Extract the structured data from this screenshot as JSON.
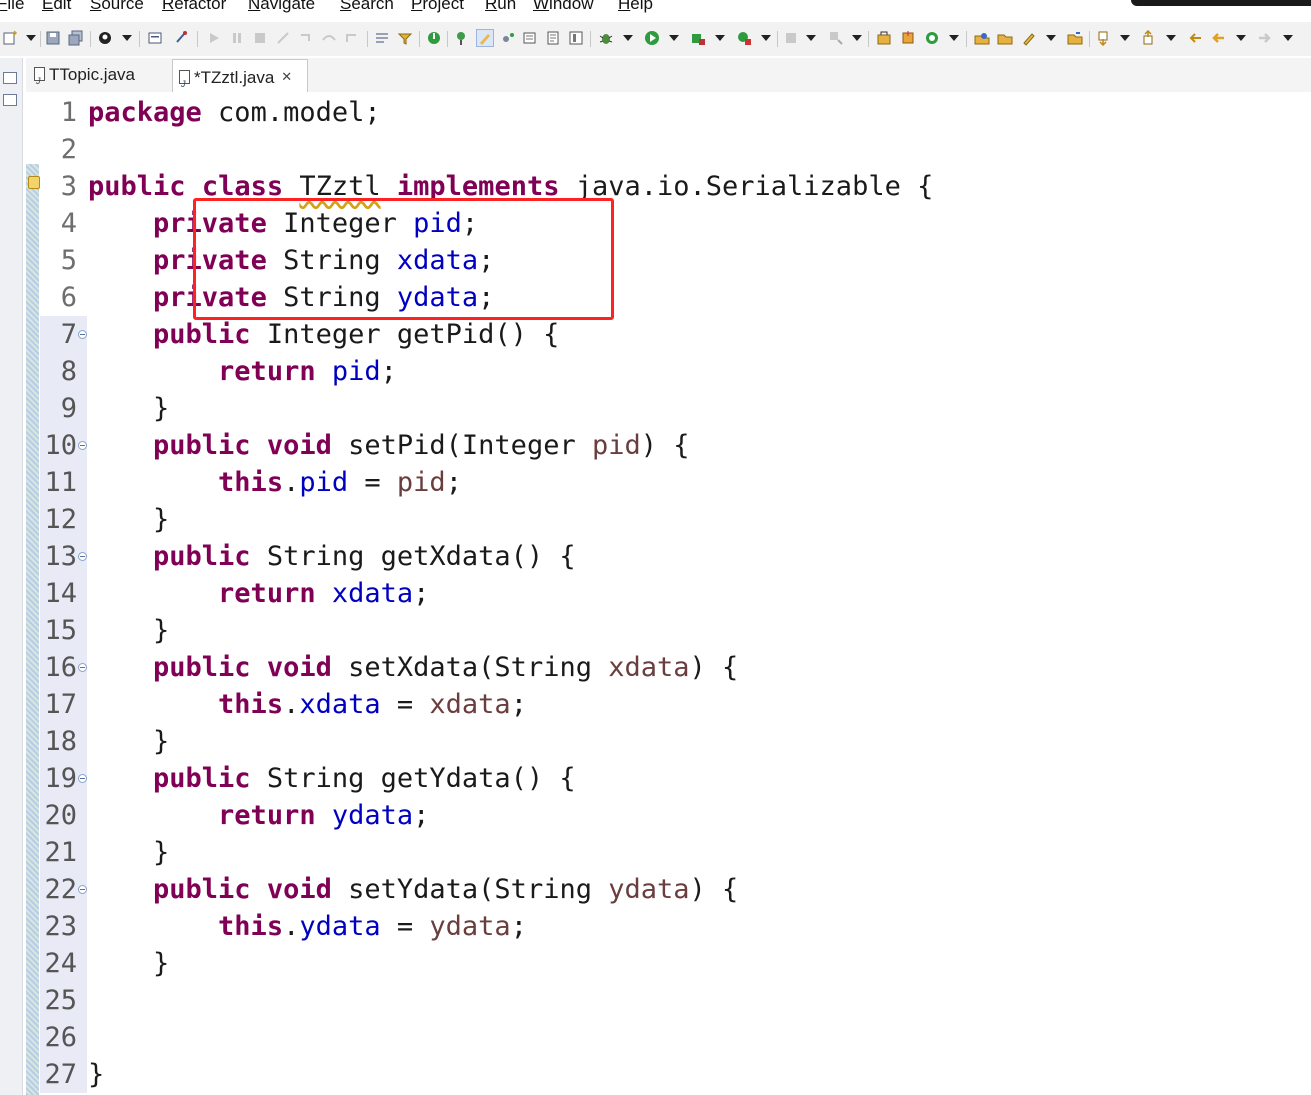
{
  "menubar": {
    "items": [
      "File",
      "Edit",
      "Source",
      "Refactor",
      "Navigate",
      "Search",
      "Project",
      "Run",
      "Window",
      "Help"
    ]
  },
  "toolbar": {
    "icons": [
      "new-icon",
      "save-icon",
      "save-all-icon",
      "profile-icon",
      "console-icon",
      "pin-icon",
      "resume-icon",
      "suspend-icon",
      "terminate-icon",
      "disconnect-icon",
      "step-into-icon",
      "step-over-icon",
      "step-return-icon",
      "drop-to-frame-icon",
      "use-step-filters-icon",
      "new-server-icon",
      "publish-icon",
      "open-type-icon",
      "open-task-icon",
      "debug-icon",
      "run-icon",
      "coverage-icon",
      "external-tools-icon",
      "stop-icon",
      "build-icon",
      "new-java-package-icon",
      "new-java-class-icon",
      "open-perspective-icon",
      "search-icon",
      "open-folder-icon",
      "annotation-icon",
      "next-annotation-icon",
      "prev-annotation-icon",
      "last-edit-icon",
      "back-icon",
      "forward-icon"
    ]
  },
  "editor": {
    "tabs": [
      {
        "label": "TTopic.java",
        "active": false
      },
      {
        "label": "*TZztl.java",
        "active": true,
        "close": "✕"
      }
    ],
    "lines": [
      {
        "n": "1"
      },
      {
        "n": "2"
      },
      {
        "n": "3"
      },
      {
        "n": "4"
      },
      {
        "n": "5"
      },
      {
        "n": "6"
      },
      {
        "n": "7"
      },
      {
        "n": "8"
      },
      {
        "n": "9"
      },
      {
        "n": "10"
      },
      {
        "n": "11"
      },
      {
        "n": "12"
      },
      {
        "n": "13"
      },
      {
        "n": "14"
      },
      {
        "n": "15"
      },
      {
        "n": "16"
      },
      {
        "n": "17"
      },
      {
        "n": "18"
      },
      {
        "n": "19"
      },
      {
        "n": "20"
      },
      {
        "n": "21"
      },
      {
        "n": "22"
      },
      {
        "n": "23"
      },
      {
        "n": "24"
      },
      {
        "n": "25"
      },
      {
        "n": "26"
      },
      {
        "n": "27"
      }
    ],
    "code": {
      "l1": {
        "kw": "package",
        "rest": " com.model;"
      },
      "l3": {
        "kw1": "public",
        "kw2": "class",
        "cls": "TZztl",
        "kw3": "implements",
        "rest": " java.io.Serializable {"
      },
      "l4": {
        "indent": "    ",
        "kw": "private",
        "type": " Integer ",
        "fld": "pid",
        "end": ";"
      },
      "l5": {
        "indent": "    ",
        "kw": "private",
        "type": " String ",
        "fld": "xdata",
        "end": ";"
      },
      "l6": {
        "indent": "    ",
        "kw": "private",
        "type": " String ",
        "fld": "ydata",
        "end": ";"
      },
      "l7": {
        "indent": "    ",
        "kw": "public",
        "rest": " Integer getPid() {"
      },
      "l8": {
        "indent": "        ",
        "kw": "return",
        "sp": " ",
        "fld": "pid",
        "end": ";"
      },
      "l9": {
        "text": "    }"
      },
      "l10": {
        "indent": "    ",
        "kw1": "public",
        "kw2": "void",
        "mid": " setPid(Integer ",
        "prm": "pid",
        "end": ") {"
      },
      "l11": {
        "indent": "        ",
        "kw": "this",
        "dot": ".",
        "fld": "pid",
        "eq": " = ",
        "prm": "pid",
        "end": ";"
      },
      "l12": {
        "text": "    }"
      },
      "l13": {
        "indent": "    ",
        "kw": "public",
        "rest": " String getXdata() {"
      },
      "l14": {
        "indent": "        ",
        "kw": "return",
        "sp": " ",
        "fld": "xdata",
        "end": ";"
      },
      "l15": {
        "text": "    }"
      },
      "l16": {
        "indent": "    ",
        "kw1": "public",
        "kw2": "void",
        "mid": " setXdata(String ",
        "prm": "xdata",
        "end": ") {"
      },
      "l17": {
        "indent": "        ",
        "kw": "this",
        "dot": ".",
        "fld": "xdata",
        "eq": " = ",
        "prm": "xdata",
        "end": ";"
      },
      "l18": {
        "text": "    }"
      },
      "l19": {
        "indent": "    ",
        "kw": "public",
        "rest": " String getYdata() {"
      },
      "l20": {
        "indent": "        ",
        "kw": "return",
        "sp": " ",
        "fld": "ydata",
        "end": ";"
      },
      "l21": {
        "text": "    }"
      },
      "l22": {
        "indent": "    ",
        "kw1": "public",
        "kw2": "void",
        "mid": " setYdata(String ",
        "prm": "ydata",
        "end": ") {"
      },
      "l23": {
        "indent": "        ",
        "kw": "this",
        "dot": ".",
        "fld": "ydata",
        "eq": " = ",
        "prm": "ydata",
        "end": ";"
      },
      "l24": {
        "text": "    }"
      },
      "l27": {
        "text": "}"
      }
    }
  },
  "colors": {
    "keyword": "#7f0055",
    "field": "#0000c0",
    "parameter": "#6a3e3e",
    "annotation_box": "#ff2222"
  }
}
